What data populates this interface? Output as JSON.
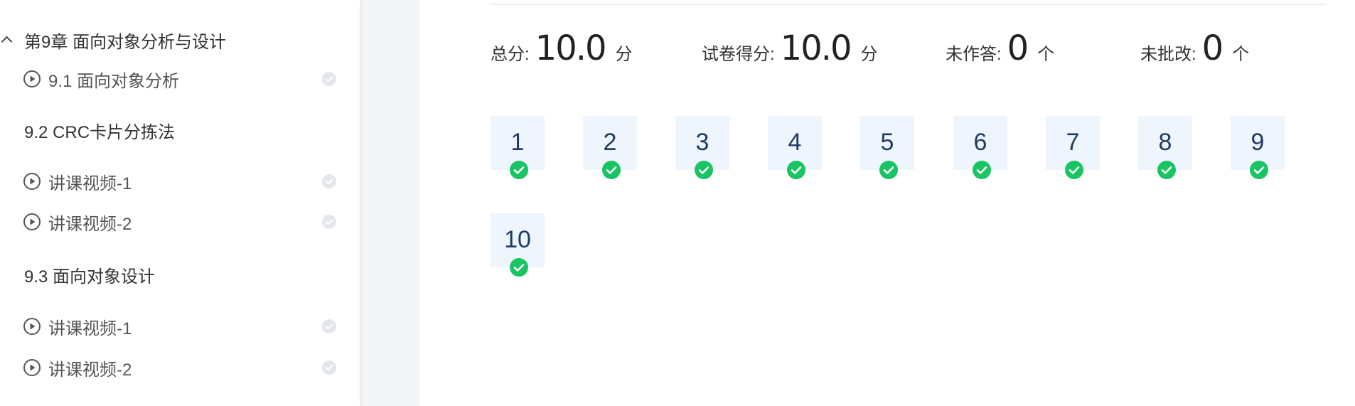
{
  "sidebar": {
    "chapter": {
      "title": "第9章 面向对象分析与设计",
      "icon": "chevron-up-icon"
    },
    "rows": [
      {
        "type": "lesson",
        "label": "9.1 面向对象分析",
        "icon": "play-circle-icon",
        "status_icon": "check-circle-icon"
      },
      {
        "type": "section",
        "label": "9.2 CRC卡片分拣法"
      },
      {
        "type": "lesson",
        "label": "讲课视频-1",
        "icon": "play-circle-icon",
        "status_icon": "check-circle-icon"
      },
      {
        "type": "lesson",
        "label": "讲课视频-2",
        "icon": "play-circle-icon",
        "status_icon": "check-circle-icon"
      },
      {
        "type": "section",
        "label": "9.3 面向对象设计"
      },
      {
        "type": "lesson",
        "label": "讲课视频-1",
        "icon": "play-circle-icon",
        "status_icon": "check-circle-icon"
      },
      {
        "type": "lesson",
        "label": "讲课视频-2",
        "icon": "play-circle-icon",
        "status_icon": "check-circle-icon"
      }
    ]
  },
  "stats": {
    "total": {
      "label": "总分:",
      "value": "10.0",
      "unit": "分"
    },
    "score": {
      "label": "试卷得分:",
      "value": "10.0",
      "unit": "分"
    },
    "unanswered": {
      "label": "未作答:",
      "value": "0",
      "unit": "个"
    },
    "ungraded": {
      "label": "未批改:",
      "value": "0",
      "unit": "个"
    }
  },
  "questions": [
    {
      "number": "1",
      "status": "correct"
    },
    {
      "number": "2",
      "status": "correct"
    },
    {
      "number": "3",
      "status": "correct"
    },
    {
      "number": "4",
      "status": "correct"
    },
    {
      "number": "5",
      "status": "correct"
    },
    {
      "number": "6",
      "status": "correct"
    },
    {
      "number": "7",
      "status": "correct"
    },
    {
      "number": "8",
      "status": "correct"
    },
    {
      "number": "9",
      "status": "correct"
    },
    {
      "number": "10",
      "status": "correct"
    }
  ],
  "colors": {
    "correct": "#19c463",
    "done_grey": "#e3e6ea",
    "tile_bg": "#eef5fd",
    "tile_text": "#1f3b63"
  }
}
